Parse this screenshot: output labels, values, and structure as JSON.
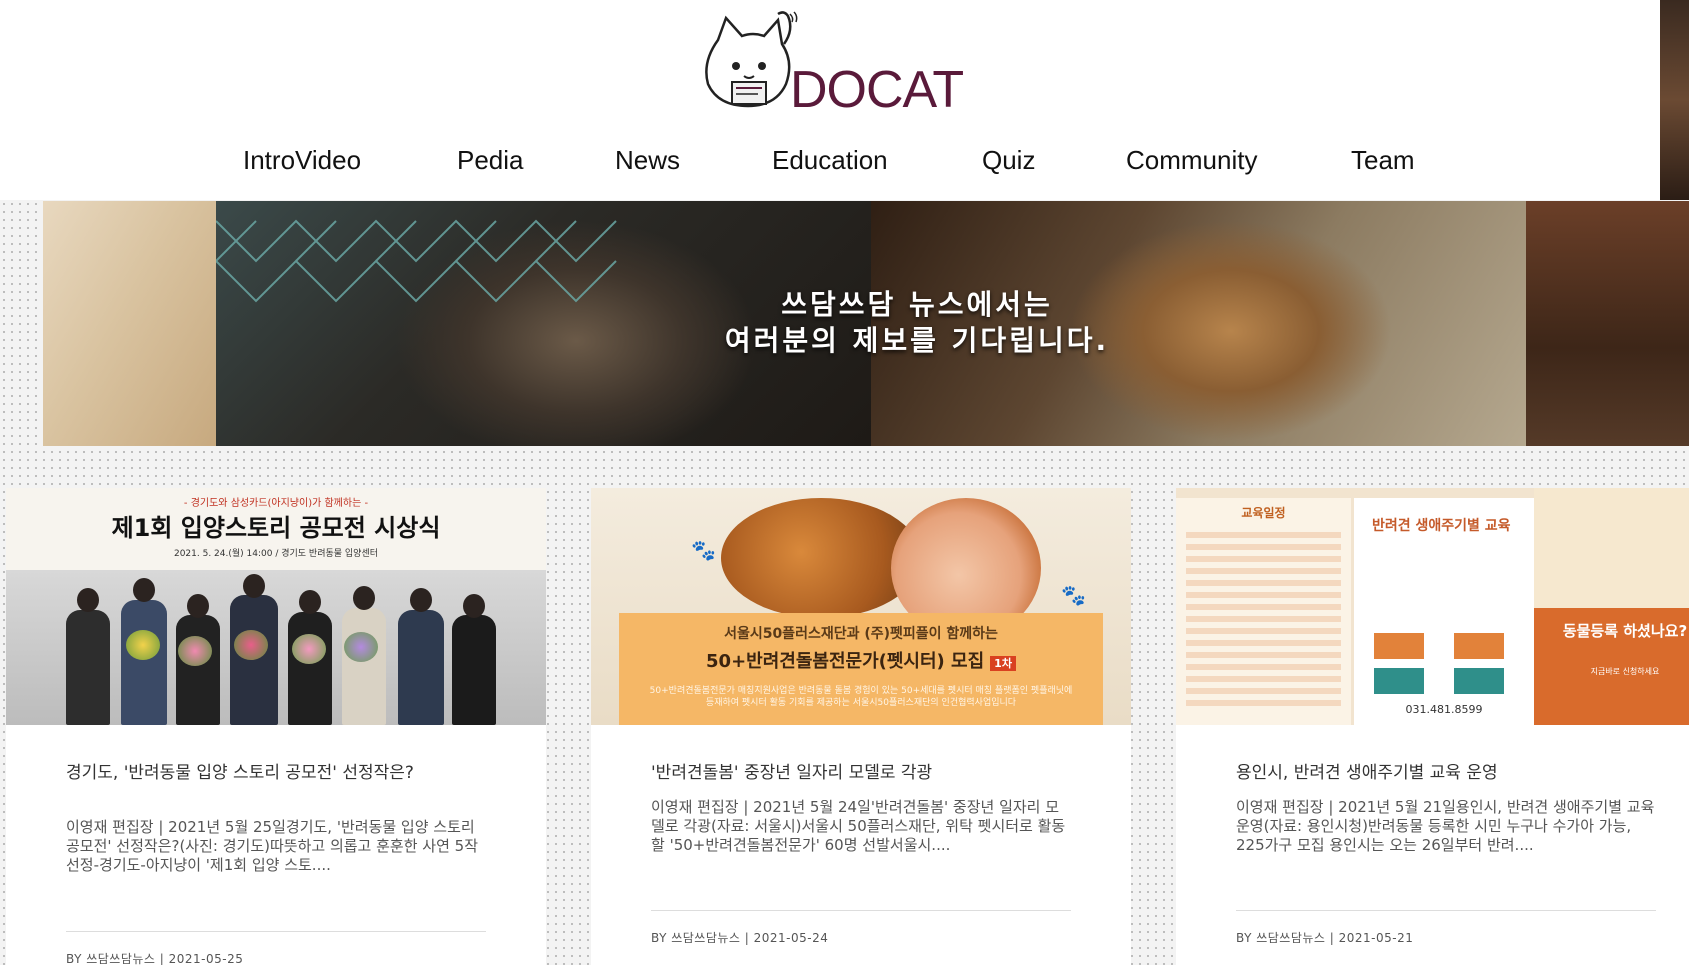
{
  "brand": {
    "name": "DOCAT",
    "text_color": "#5a1a3a"
  },
  "nav": {
    "items": [
      {
        "label": "IntroVideo"
      },
      {
        "label": "Pedia"
      },
      {
        "label": "News"
      },
      {
        "label": "Education"
      },
      {
        "label": "Quiz"
      },
      {
        "label": "Community"
      },
      {
        "label": "Team"
      }
    ]
  },
  "banner": {
    "line1": "쓰담쓰담 뉴스에서는",
    "line2": "여러분의 제보를 기다립니다."
  },
  "cards": [
    {
      "image": {
        "subtitle": "- 경기도와 삼성카드(아지냥이)가 함께하는 -",
        "title": "제1회 입양스토리 공모전 시상식",
        "date": "2021. 5. 24.(월) 14:00 / 경기도 반려동물 입양센터"
      },
      "title": "경기도, '반려동물 입양 스토리 공모전' 선정작은?",
      "excerpt": "이영재 편집장 | 2021년 5월 25일경기도, '반려동물 입양 스토리 공모전' 선정작은?(사진: 경기도)따뜻하고 의롭고 훈훈한 사연 5작 선정-경기도-아지냥이 '제1회 입양 스토....",
      "meta": "BY 쓰담쓰담뉴스  |  2021-05-25"
    },
    {
      "image": {
        "line1": "서울시50플러스재단과 (주)펫피플이 함께하는",
        "line2": "50+반려견돌봄전문가(펫시터) 모집",
        "tag": "1차",
        "line3": "50+반려견돌봄전문가 매칭지원사업은 반려동물 돌봄 경험이 있는 50+세대를 펫시터 매칭 플랫폼인 펫플래닛에 등재하여 펫시터 활동 기회를 제공하는 서울시50플러스재단의 인건협력사업입니다"
      },
      "title": "'반려견돌봄' 중장년 일자리 모델로 각광",
      "excerpt": "이영재 편집장 | 2021년 5월 24일'반려견돌봄' 중장년 일자리 모델로 각광(자료: 서울시)서울시 50플러스재단, 위탁 펫시터로 활동할 '50+반려견돌봄전문가' 60명 선발서울시....",
      "meta": "BY 쓰담쓰담뉴스  |  2021-05-24"
    },
    {
      "image": {
        "left_title": "교육일정",
        "mid_title": "반려견 생애주기별 교육",
        "phone": "031.481.8599",
        "right_title": "동물등록 하셨나요?",
        "right_sub": "지금바로 신청하세요"
      },
      "title": "용인시, 반려견 생애주기별 교육 운영",
      "excerpt": "이영재 편집장 | 2021년 5월 21일용인시, 반려견 생애주기별 교육 운영(자료: 용인시청)반려동물 등록한 시민 누구나 수가아 가능, 225가구 모집 용인시는 오는 26일부터 반려....",
      "meta": "BY 쓰담쓰담뉴스  |  2021-05-21"
    }
  ]
}
